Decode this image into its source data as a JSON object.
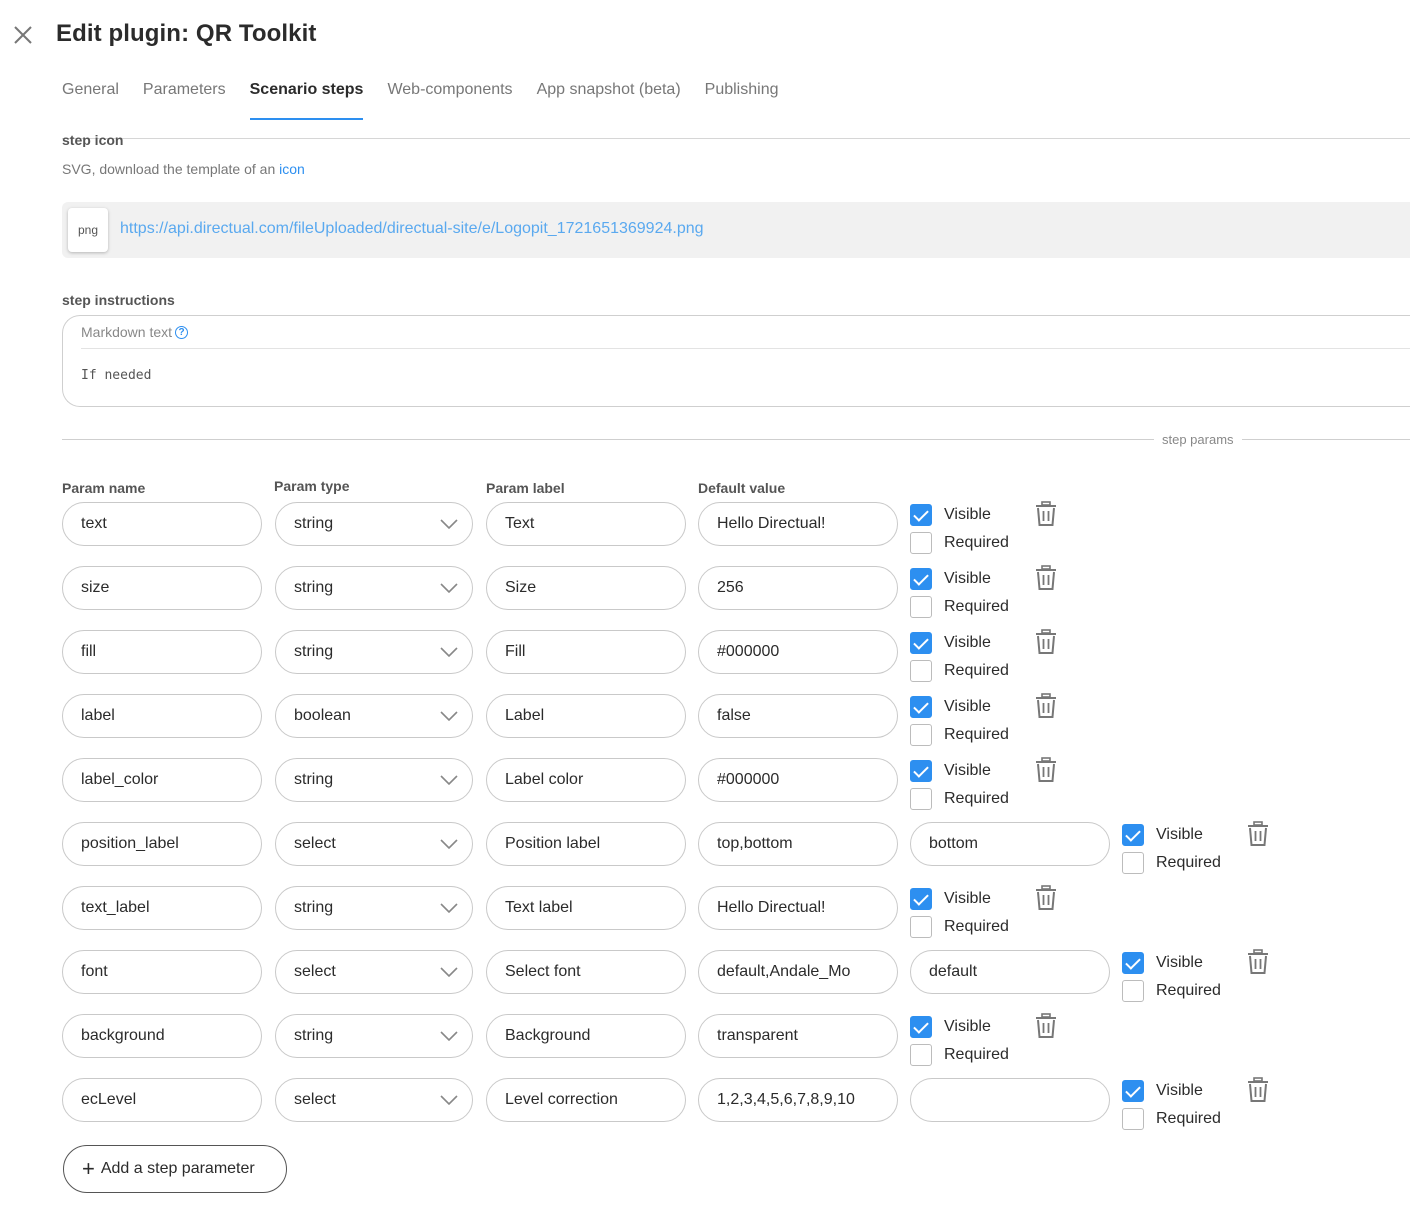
{
  "header": {
    "title": "Edit plugin: QR Toolkit"
  },
  "tabs": [
    {
      "label": "General"
    },
    {
      "label": "Parameters"
    },
    {
      "label": "Scenario steps",
      "active": true
    },
    {
      "label": "Web-components"
    },
    {
      "label": "App snapshot (beta)"
    },
    {
      "label": "Publishing"
    }
  ],
  "step_icon": {
    "label": "step icon",
    "help_text": "SVG, download the template of an ",
    "help_link": "icon",
    "file_type": "png",
    "file_url": "https://api.directual.com/fileUploaded/directual-site/e/Logopit_1721651369924.png"
  },
  "step_instructions": {
    "label": "step instructions",
    "editor_label": "Markdown text",
    "content": "If needed"
  },
  "params_section": {
    "title": "step params",
    "headers": {
      "name": "Param name",
      "type": "Param type",
      "label": "Param label",
      "default": "Default value"
    },
    "visible_label": "Visible",
    "required_label": "Required",
    "rows": [
      {
        "name": "text",
        "type": "string",
        "label": "Text",
        "default": "Hello Directual!",
        "extra": null,
        "visible": true,
        "required": false
      },
      {
        "name": "size",
        "type": "string",
        "label": "Size",
        "default": "256",
        "extra": null,
        "visible": true,
        "required": false
      },
      {
        "name": "fill",
        "type": "string",
        "label": "Fill",
        "default": "#000000",
        "extra": null,
        "visible": true,
        "required": false
      },
      {
        "name": "label",
        "type": "boolean",
        "label": "Label",
        "default": "false",
        "extra": null,
        "visible": true,
        "required": false
      },
      {
        "name": "label_color",
        "type": "string",
        "label": "Label color",
        "default": "#000000",
        "extra": null,
        "visible": true,
        "required": false
      },
      {
        "name": "position_label",
        "type": "select",
        "label": "Position label",
        "default": "top,bottom",
        "extra": "bottom",
        "visible": true,
        "required": false
      },
      {
        "name": "text_label",
        "type": "string",
        "label": "Text label",
        "default": "Hello Directual!",
        "extra": null,
        "visible": true,
        "required": false
      },
      {
        "name": "font",
        "type": "select",
        "label": "Select font",
        "default": "default,Andale_Mo",
        "extra": "default",
        "visible": true,
        "required": false
      },
      {
        "name": "background",
        "type": "string",
        "label": "Background",
        "default": "transparent",
        "extra": null,
        "visible": true,
        "required": false
      },
      {
        "name": "ecLevel",
        "type": "select",
        "label": "Level correction",
        "default": "1,2,3,4,5,6,7,8,9,10",
        "extra": "",
        "visible": true,
        "required": false
      }
    ],
    "add_button": "Add a step parameter"
  },
  "colors": {
    "accent": "#2d8ff0",
    "link": "#5aa9ef",
    "border": "#c9c9c9"
  },
  "icons": [
    "close-icon",
    "chevron-down-icon",
    "trash-icon",
    "help-circle-icon",
    "plus-icon",
    "checkbox-icon"
  ]
}
